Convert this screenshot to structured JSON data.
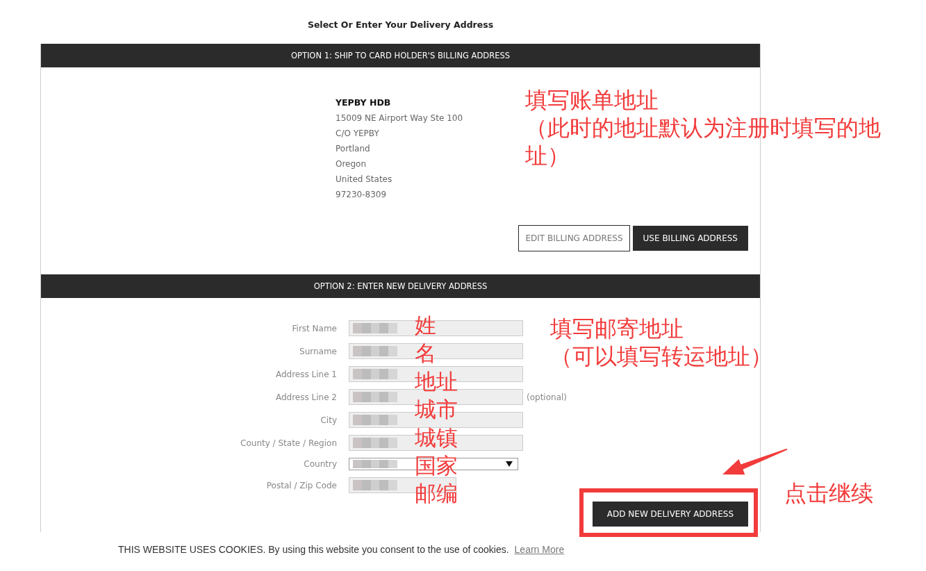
{
  "page": {
    "title": "Select Or Enter Your Delivery Address"
  },
  "option_1": {
    "header": "OPTION 1: SHIP TO CARD HOLDER'S BILLING ADDRESS",
    "address": {
      "name": "YEPBY HDB",
      "lines": [
        "15009 NE Airport Way Ste 100",
        "C/O YEPBY",
        "Portland",
        "Oregon",
        "United States",
        "97230-8309"
      ]
    },
    "buttons": [
      {
        "label": "EDIT BILLING ADDRESS",
        "kind": "outline"
      },
      {
        "label": "USE BILLING ADDRESS",
        "kind": "filled"
      }
    ]
  },
  "option_2": {
    "header": "OPTION 2: ENTER NEW DELIVERY ADDRESS",
    "fields": [
      {
        "label": "First Name",
        "kind": "text",
        "redacted": true
      },
      {
        "label": "Surname",
        "kind": "text",
        "redacted": true
      },
      {
        "label": "Address Line 1",
        "kind": "text",
        "redacted": true
      },
      {
        "label": "Address Line 2",
        "kind": "text",
        "redacted": true,
        "note": "(optional)"
      },
      {
        "label": "City",
        "kind": "text",
        "redacted": true
      },
      {
        "label": "County / State / Region",
        "kind": "text",
        "redacted": true
      },
      {
        "label": "Country",
        "kind": "select",
        "redacted": true
      },
      {
        "label": "Postal / Zip Code",
        "kind": "short",
        "redacted": true
      }
    ],
    "submit_button": {
      "label": "ADD NEW DELIVERY ADDRESS",
      "highlighted": true
    }
  },
  "annotations": {
    "billing_note": [
      "填写账单地址",
      "（此时的地址默认为注册时填写的地址）"
    ],
    "delivery_note": [
      "填写邮寄地址",
      "（可以填写转运地址）"
    ],
    "field_notes": [
      "姓",
      "名",
      "地址",
      "城市",
      "城镇",
      "国家",
      "邮编"
    ],
    "click_note": "点击继续"
  },
  "cookie_banner": {
    "message": "THIS WEBSITE USES COOKIES. By using this website you consent to the use of cookies.",
    "link": "Learn More"
  }
}
